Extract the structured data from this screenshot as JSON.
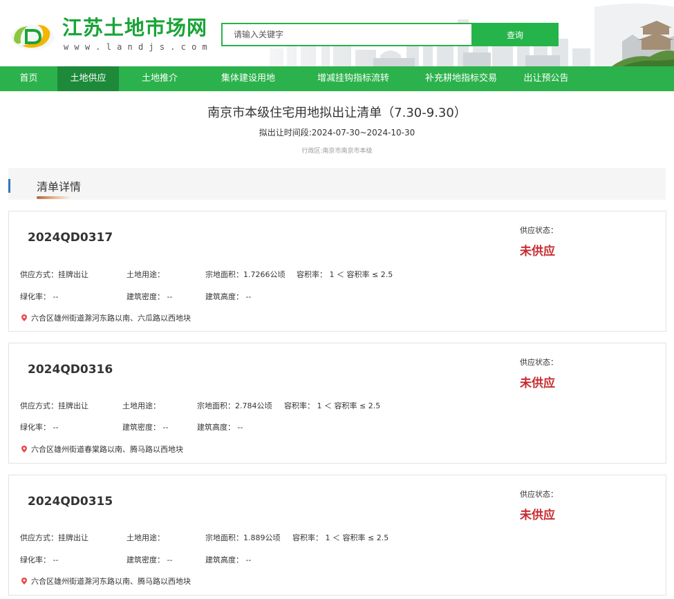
{
  "site": {
    "name": "江苏土地市场网",
    "domain": "www.landjs.com"
  },
  "search": {
    "placeholder": "请输入关键字",
    "button_label": "查询"
  },
  "nav": {
    "items": [
      {
        "label": "首页"
      },
      {
        "label": "土地供应"
      },
      {
        "label": "土地推介"
      },
      {
        "label": "集体建设用地"
      },
      {
        "label": "增减挂钩指标流转"
      },
      {
        "label": "补充耕地指标交易"
      },
      {
        "label": "出让预公告"
      }
    ],
    "active_index": 1
  },
  "page": {
    "title": "南京市本级住宅用地拟出让清单（7.30-9.30）",
    "period": "拟出让时间段:2024-07-30~2024-10-30",
    "region": "行政区:南京市南京市本级"
  },
  "section": {
    "title": "清单详情"
  },
  "colors": {
    "brand_green": "#2cb24c",
    "nav_active": "#1d8a3a",
    "status_red": "#c8292e",
    "accent_blue": "#2e78c2"
  },
  "parcels": [
    {
      "code": "2024QD0317",
      "status_label": "供应状态：",
      "status": "未供应",
      "supply_method": "供应方式：挂牌出让",
      "land_use": "土地用途：",
      "area": "宗地面积：1.7266公顷",
      "plot_ratio": "容积率： 1 ＜ 容积率 ≤ 2.5",
      "green_rate": "绿化率： --",
      "building_density": "建筑密度： --",
      "building_height": "建筑高度： --",
      "address": "六合区雄州街道滁河东路以南、六瓜路以西地块"
    },
    {
      "code": "2024QD0316",
      "status_label": "供应状态：",
      "status": "未供应",
      "supply_method": "供应方式：挂牌出让",
      "land_use": "土地用途：",
      "area": "宗地面积：2.784公顷",
      "plot_ratio": "容积率： 1 ＜ 容积率 ≤ 2.5",
      "green_rate": "绿化率： --",
      "building_density": "建筑密度： --",
      "building_height": "建筑高度： --",
      "address": "六合区雄州街道春棠路以南、腾马路以西地块"
    },
    {
      "code": "2024QD0315",
      "status_label": "供应状态：",
      "status": "未供应",
      "supply_method": "供应方式：挂牌出让",
      "land_use": "土地用途：",
      "area": "宗地面积：1.889公顷",
      "plot_ratio": "容积率： 1 ＜ 容积率 ≤ 2.5",
      "green_rate": "绿化率： --",
      "building_density": "建筑密度： --",
      "building_height": "建筑高度： --",
      "address": "六合区雄州街道滁河东路以南、腾马路以西地块"
    }
  ]
}
